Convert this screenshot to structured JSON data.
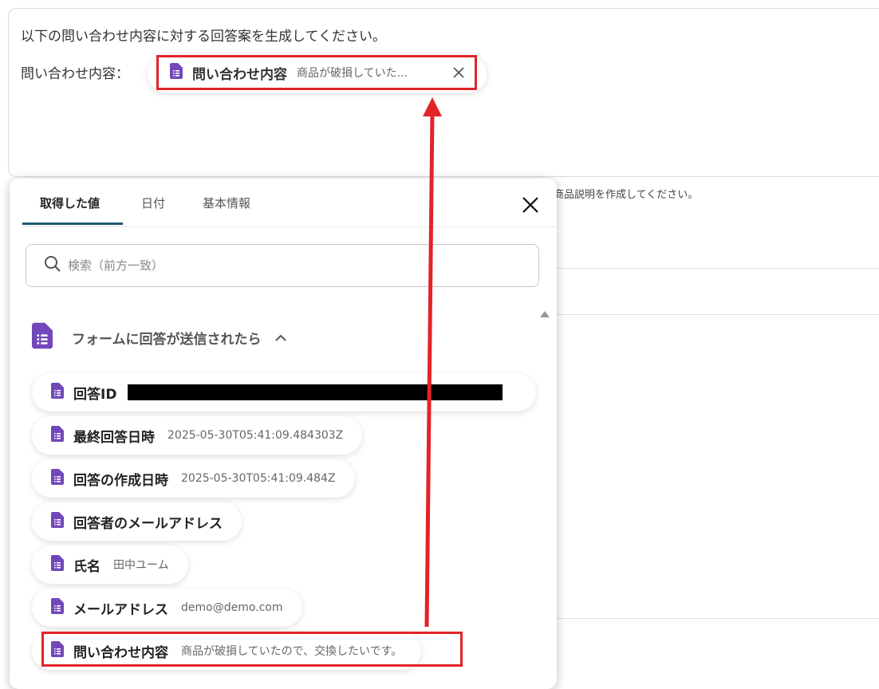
{
  "editor": {
    "prompt_text": "以下の問い合わせ内容に対する回答案を生成してください。",
    "label_text": "問い合わせ内容：",
    "chip": {
      "label": "問い合わせ内容",
      "value": "商品が破損していた..."
    }
  },
  "background": {
    "partial_text": "商品説明を作成してください。"
  },
  "popup": {
    "tabs": [
      {
        "label": "取得した値",
        "active": true
      },
      {
        "label": "日付",
        "active": false
      },
      {
        "label": "基本情報",
        "active": false
      }
    ],
    "search_placeholder": "検索（前方一致）",
    "group_title": "フォームに回答が送信されたら",
    "items": [
      {
        "label": "回答ID",
        "value": "",
        "redacted": true
      },
      {
        "label": "最終回答日時",
        "value": "2025-05-30T05:41:09.484303Z"
      },
      {
        "label": "回答の作成日時",
        "value": "2025-05-30T05:41:09.484Z"
      },
      {
        "label": "回答者のメールアドレス",
        "value": ""
      },
      {
        "label": "氏名",
        "value": "田中ユーム"
      },
      {
        "label": "メールアドレス",
        "value": "demo@demo.com"
      },
      {
        "label": "問い合わせ内容",
        "value": "商品が破損していたので、交換したいです。"
      }
    ]
  },
  "colors": {
    "accent_tab": "#1d5a73",
    "doc_icon": "#7248b9",
    "highlight": "#e3232a"
  },
  "icons": [
    "document-icon",
    "close-icon",
    "search-icon",
    "chevron-up-icon",
    "scroll-up-icon"
  ]
}
